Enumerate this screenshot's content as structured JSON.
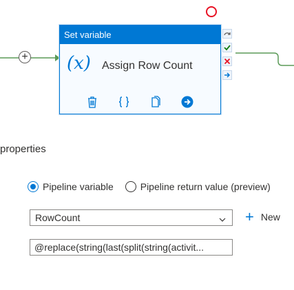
{
  "activity": {
    "type_label": "Set variable",
    "name": "Assign Row Count",
    "icon": "variable-x-icon",
    "actions": [
      "delete-icon",
      "code-icon",
      "copy-icon",
      "go-arrow-icon"
    ]
  },
  "properties": {
    "heading": "properties",
    "radio_options": [
      {
        "label": "Pipeline variable",
        "checked": true
      },
      {
        "label": "Pipeline return value (preview)",
        "checked": false
      }
    ],
    "variable_select": {
      "value": "RowCount"
    },
    "new_button_label": "New",
    "value_field": "@replace(string(last(split(string(activit..."
  },
  "colors": {
    "accent": "#0078d4",
    "success": "#107c10",
    "error": "#e81123",
    "connector": "#5a9a57"
  }
}
